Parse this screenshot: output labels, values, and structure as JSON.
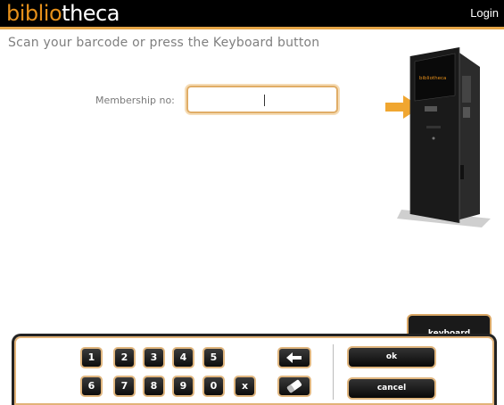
{
  "header": {
    "logo_part1": "biblio",
    "logo_part2": "theca",
    "login_label": "Login"
  },
  "main": {
    "instruction": "Scan your barcode or press the Keyboard button",
    "membership_label": "Membership no:",
    "membership_value": "",
    "kiosk_logo": "bibliotheca"
  },
  "keyboard_tab": {
    "label": "keyboard"
  },
  "keypad": {
    "row1": [
      "1",
      "2",
      "3",
      "4",
      "5"
    ],
    "row2": [
      "6",
      "7",
      "8",
      "9",
      "0",
      "x"
    ],
    "ok_label": "ok",
    "cancel_label": "cancel"
  },
  "colors": {
    "accent": "#e58f1a",
    "button_border": "#e0b67f",
    "header_bg": "#000000"
  }
}
